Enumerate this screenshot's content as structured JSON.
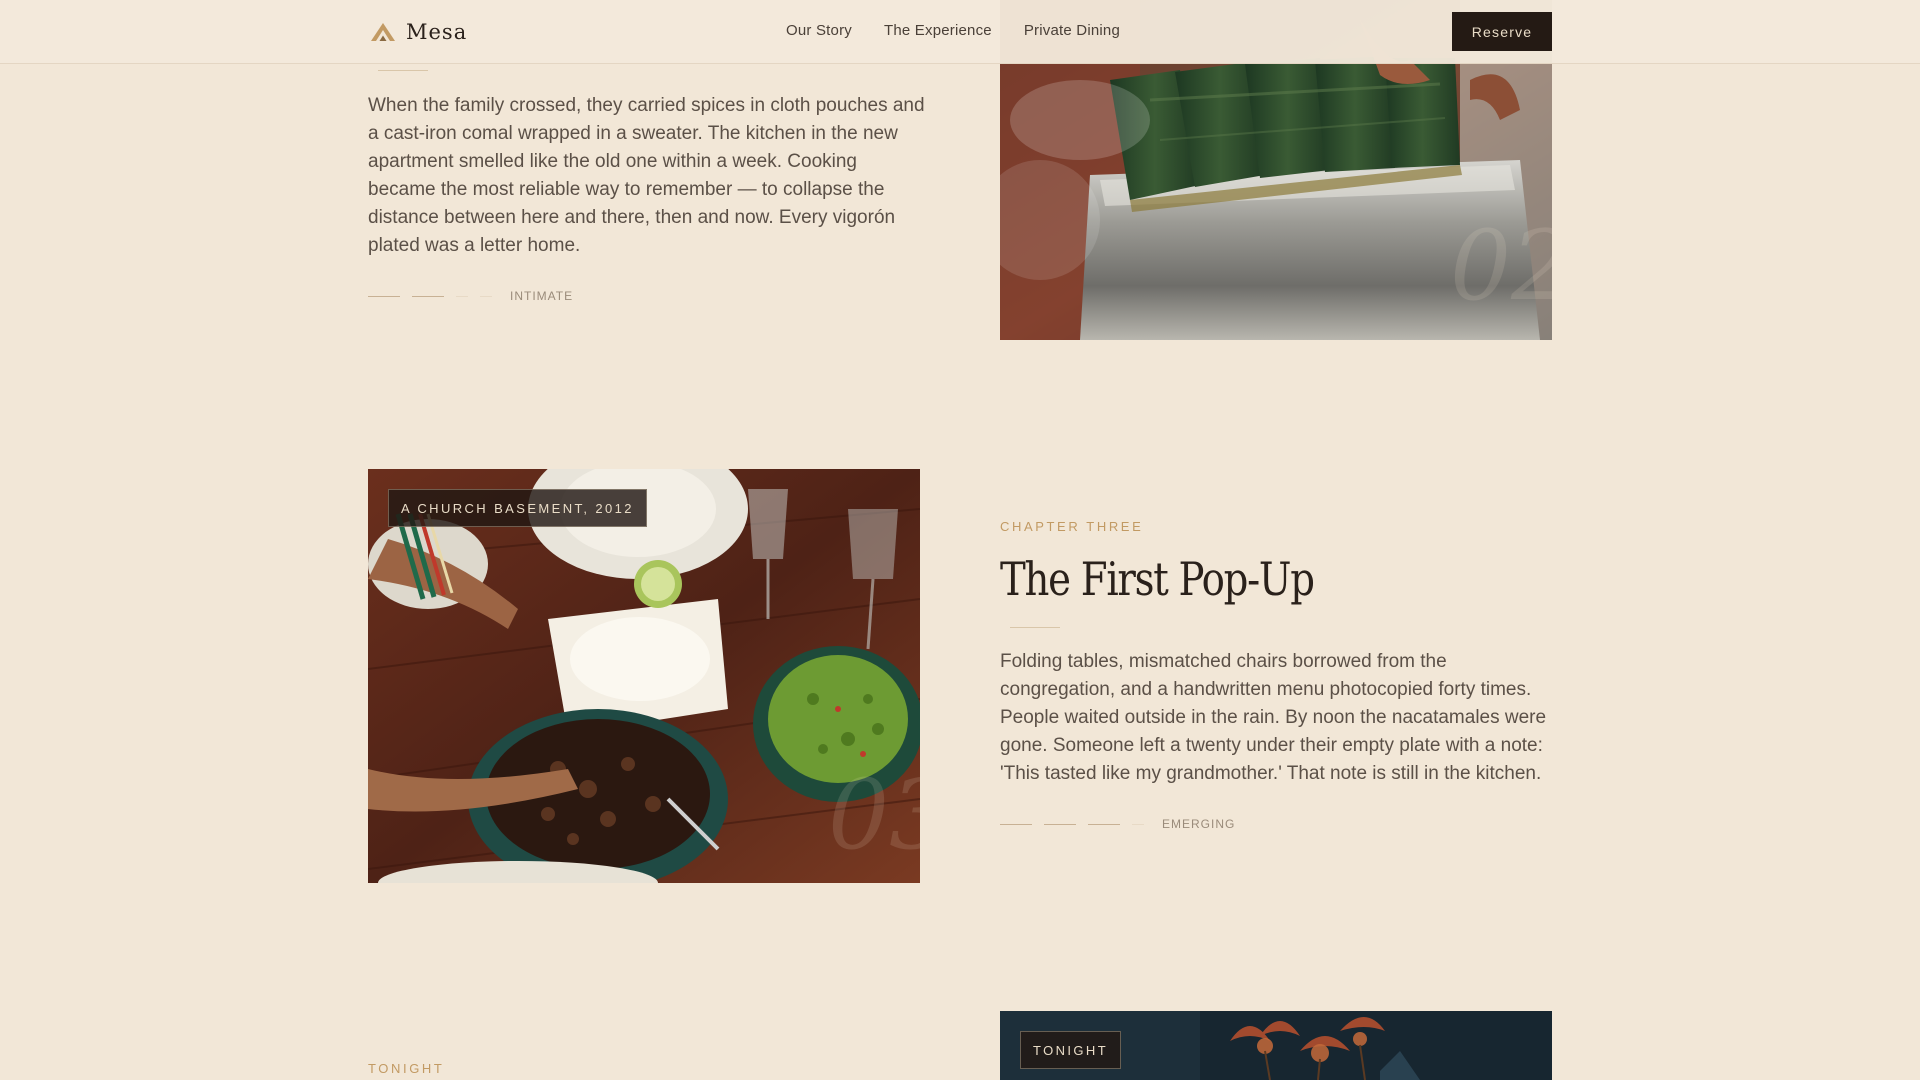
{
  "header": {
    "brand": "Mesa",
    "nav": [
      "Our Story",
      "The Experience",
      "Private Dining"
    ],
    "reserve_label": "Reserve"
  },
  "chapter_two": {
    "body": "When the family crossed, they carried spices in cloth pouches and a cast-iron comal wrapped in a sweater. The kitchen in the new apartment smelled like the old one within a week. Cooking became the most reliable way to remember — to collapse the distance between here and there, then and now. Every vigorón plated was a letter home.",
    "intensity": {
      "level": 2,
      "of": 4,
      "label": "INTIMATE"
    }
  },
  "chapter_three": {
    "eyebrow": "CHAPTER THREE",
    "title": "The First Pop-Up",
    "body": "Folding tables, mismatched chairs borrowed from the congregation, and a handwritten menu photocopied forty times. People waited outside in the rain. By noon the nacatamales were gone. Someone left a twenty under their empty plate with a note: 'This tasted like my grandmother.' That note is still in the kitchen.",
    "photo_caption": "A CHURCH BASEMENT, 2012",
    "intensity": {
      "level": 3,
      "of": 4,
      "label": "EMERGING"
    }
  },
  "tonight": {
    "eyebrow": "TONIGHT",
    "photo_caption": "TONIGHT"
  },
  "colors": {
    "background": "#f2e7d7",
    "accent": "#c29a63",
    "dark": "#241a14"
  }
}
